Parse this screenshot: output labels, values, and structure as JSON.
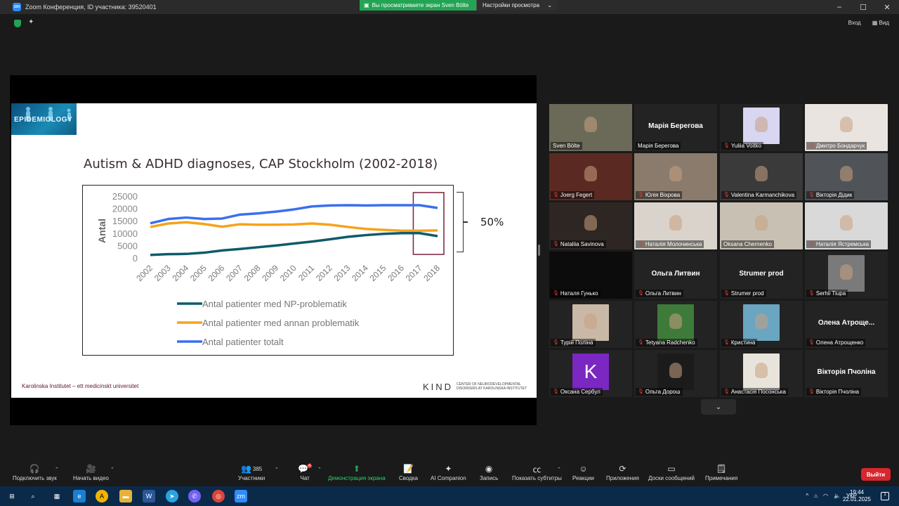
{
  "window": {
    "title": "Zoom Конференция, ID участника: 39520401",
    "minimize": "‒",
    "maximize": "☐",
    "close": "✕"
  },
  "share_banner": {
    "viewing": "Вы просматриваете экран Sven Bölte",
    "settings": "Настройки просмотра"
  },
  "top_right": {
    "enter": "Вход",
    "view": "Вид"
  },
  "slide": {
    "banner": "EPIDEMIOLOGY",
    "title": "Autism & ADHD diagnoses, CAP Stockholm (2002-2018)",
    "annotation": "50%",
    "footer_left": "Karolinska Institutet – ett medicinskt universitet",
    "footer_logo": "KIND",
    "footer_logo_sub": "CENTER OF NEURODEVELOPMENTAL DISORDERS AT KAROLINSKA INSTITUTET"
  },
  "chart_data": {
    "type": "line",
    "title": "",
    "ylabel": "Antal",
    "xlabel": "",
    "x": [
      "2002",
      "2003",
      "2004",
      "2005",
      "2006",
      "2007",
      "2008",
      "2009",
      "2010",
      "2011",
      "2012",
      "2013",
      "2014",
      "2015",
      "2016",
      "2017",
      "2018"
    ],
    "yticks": [
      "25000",
      "20000",
      "15000",
      "10000",
      "5000",
      "0"
    ],
    "ylim": [
      0,
      25000
    ],
    "series": [
      {
        "name": "Antal patienter med NP-problematik",
        "color": "#0e5b6b",
        "values": [
          1500,
          1800,
          1900,
          2400,
          3300,
          3900,
          4600,
          5300,
          6100,
          6900,
          7800,
          8800,
          9500,
          10000,
          10300,
          10300,
          9100
        ]
      },
      {
        "name": "Antal patienter med annan problematik",
        "color": "#f7a21b",
        "values": [
          12800,
          14200,
          14700,
          14000,
          12900,
          13900,
          13700,
          13700,
          13800,
          14200,
          13700,
          12800,
          12000,
          11600,
          11300,
          11300,
          11400
        ]
      },
      {
        "name": "Antal patienter totalt",
        "color": "#3a6ff0",
        "values": [
          14300,
          16000,
          16600,
          16000,
          16200,
          17800,
          18300,
          19000,
          19900,
          21100,
          21500,
          21600,
          21500,
          21600,
          21600,
          21600,
          20500
        ]
      }
    ],
    "highlight": "2017–2018"
  },
  "participants": [
    {
      "name": "Sven Bölte",
      "type": "video",
      "muted": false,
      "active": true,
      "bg": "#6b6a58"
    },
    {
      "name": "Марія Берегова",
      "type": "name",
      "muted": false
    },
    {
      "name": "Yuliia Voitko",
      "type": "image",
      "muted": true,
      "bg": "#d8d6f0"
    },
    {
      "name": "Дмитро Бондарчук",
      "type": "video",
      "muted": true,
      "bg": "#e9e4df"
    },
    {
      "name": "Joerg Fegert",
      "type": "video",
      "muted": true,
      "bg": "#5a2a22"
    },
    {
      "name": "Юлія Віхрова",
      "type": "video",
      "muted": true,
      "bg": "#8a7b6c"
    },
    {
      "name": "Valentina Karmanchikova",
      "type": "video",
      "muted": true,
      "bg": "#3b3a3b"
    },
    {
      "name": "Вікторія Дідик",
      "type": "video",
      "muted": true,
      "bg": "#505458"
    },
    {
      "name": "Nataliia Savinova",
      "type": "video",
      "muted": true,
      "bg": "#2e2622"
    },
    {
      "name": "Наталія Молочинська",
      "type": "video",
      "muted": true,
      "bg": "#d9d3cb"
    },
    {
      "name": "Oksana Chernenko",
      "type": "video",
      "muted": false,
      "bg": "#c8c0b2"
    },
    {
      "name": "Наталія Ястремська",
      "type": "video",
      "muted": true,
      "bg": "#d9d9d9"
    },
    {
      "name": "Наталя Гунько",
      "type": "video",
      "muted": true,
      "bg": "#0c0c0c"
    },
    {
      "name": "Ольга Литвин",
      "type": "name",
      "muted": true
    },
    {
      "name": "Strumer prod",
      "type": "name",
      "muted": true
    },
    {
      "name": "Serhii Tiupa",
      "type": "image",
      "muted": true,
      "bg": "#7a7a7a"
    },
    {
      "name": "Турій Поліна",
      "type": "image",
      "muted": true,
      "bg": "#c9b8a6"
    },
    {
      "name": "Tetyana Radchenko",
      "type": "image",
      "muted": true,
      "bg": "#3e7b3a"
    },
    {
      "name": "Кристина",
      "type": "image",
      "muted": true,
      "bg": "#6aa5c2"
    },
    {
      "name": "Олена Атрощенко",
      "type": "name",
      "display": "Олена Атроще...",
      "muted": true
    },
    {
      "name": "Оксана Сербул",
      "type": "avatar",
      "letter": "K",
      "muted": true,
      "bg": "#7b27c2"
    },
    {
      "name": "Ольга Дорош",
      "type": "image",
      "muted": true,
      "bg": "#1b1b1b"
    },
    {
      "name": "Анастасія Посонська",
      "type": "image",
      "muted": true,
      "bg": "#e8e4dc"
    },
    {
      "name": "Вікторія Пчоліна",
      "type": "name",
      "muted": true
    }
  ],
  "toolbar": {
    "audio": "Подключить звук",
    "video": "Начать видео",
    "participants": "Участники",
    "participants_count": "385",
    "chat": "Чат",
    "chat_badge": "4",
    "share": "Демонстрация экрана",
    "summary": "Сводка",
    "ai": "AI Companion",
    "record": "Запись",
    "captions": "Показать субтитры",
    "reactions": "Реакции",
    "apps": "Приложения",
    "whiteboards": "Доски сообщений",
    "notes": "Примечания",
    "leave": "Выйти"
  },
  "taskbar": {
    "lang": "УКР",
    "time": "19:44",
    "date": "22.01.2025"
  },
  "colors": {
    "share_green": "#23a455",
    "leave_red": "#d9262c",
    "active_outline": "#d6d64a"
  }
}
